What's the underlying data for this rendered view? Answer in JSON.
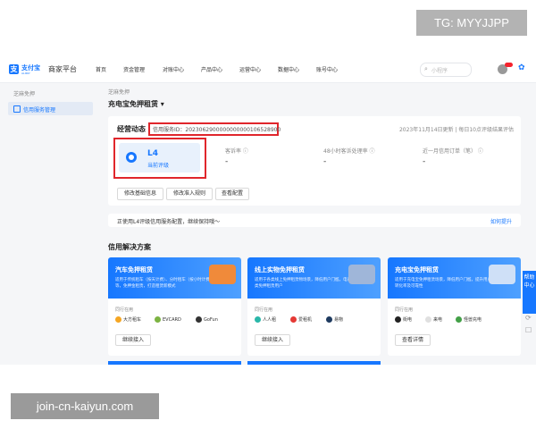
{
  "watermark": {
    "top": "TG: MYYJJPP",
    "bottom": "join-cn-kaiyun.com"
  },
  "brand": {
    "logo_glyph": "支",
    "name": "支付宝",
    "sub": "ALIPAY",
    "platform": "商家平台"
  },
  "nav": [
    "首页",
    "资金管理",
    "对账中心",
    "产品中心",
    "运营中心",
    "数据中心",
    "账号中心"
  ],
  "search": {
    "placeholder": "小程序"
  },
  "sidebar": {
    "section": "芝麻免押",
    "item": "信用服务管理"
  },
  "breadcrumb": "芝麻免押",
  "page_title": "充电宝免押租赁 ▾",
  "business": {
    "title": "经营动态",
    "service_id": "信用服务ID：2023062900000000000106528900",
    "updated": "2023年11月14日更新 | 每日10点评级结果评估",
    "level": "L4",
    "level_sub": "当前评级",
    "metrics": [
      {
        "label": "客诉率 ⓘ",
        "value": "-"
      },
      {
        "label": "48小时客诉处理率 ⓘ",
        "value": "-"
      },
      {
        "label": "近一月信用订单（笔） ⓘ",
        "value": "-"
      }
    ],
    "buttons": [
      "修改基础信息",
      "修改准入规则",
      "查看配置"
    ]
  },
  "notice": {
    "text": "正使用L4评级信用服务配置，继续保持哦～",
    "link": "如何提升"
  },
  "solutions": {
    "title": "信用解决方案",
    "cards": [
      {
        "name": "汽车免押租赁",
        "desc": "适用于传统租车（按天计费）、分时租车（按小时计费）等，免押金租赁，打造租赁新模式",
        "partners_label": "同行在用",
        "partners": [
          "大方租车",
          "EVCARD",
          "GoFun"
        ],
        "button": "继续接入",
        "color": "#f08a3a"
      },
      {
        "name": "线上实物免押租赁",
        "desc": "适用于各类线上免押租赁物场景，降低用户门槛，电商类免押租赁用户",
        "partners_label": "同行在用",
        "partners": [
          "人人租",
          "爱租机",
          "易物"
        ],
        "button": "继续接入",
        "color": "#9fb6d9"
      },
      {
        "name": "充电宝免押租赁",
        "desc": "适用于充电宝免押租赁场景，降低用户门槛，提升用户转化率及可靠性",
        "partners_label": "同行在用",
        "partners": [
          "街电",
          "来电",
          "怪兽充电"
        ],
        "button": "查看详情",
        "color": "#cfe0f7"
      }
    ]
  },
  "float": {
    "help": "帮助中心"
  },
  "colors": {
    "accent": "#1677ff",
    "highlight": "#e0262c"
  }
}
